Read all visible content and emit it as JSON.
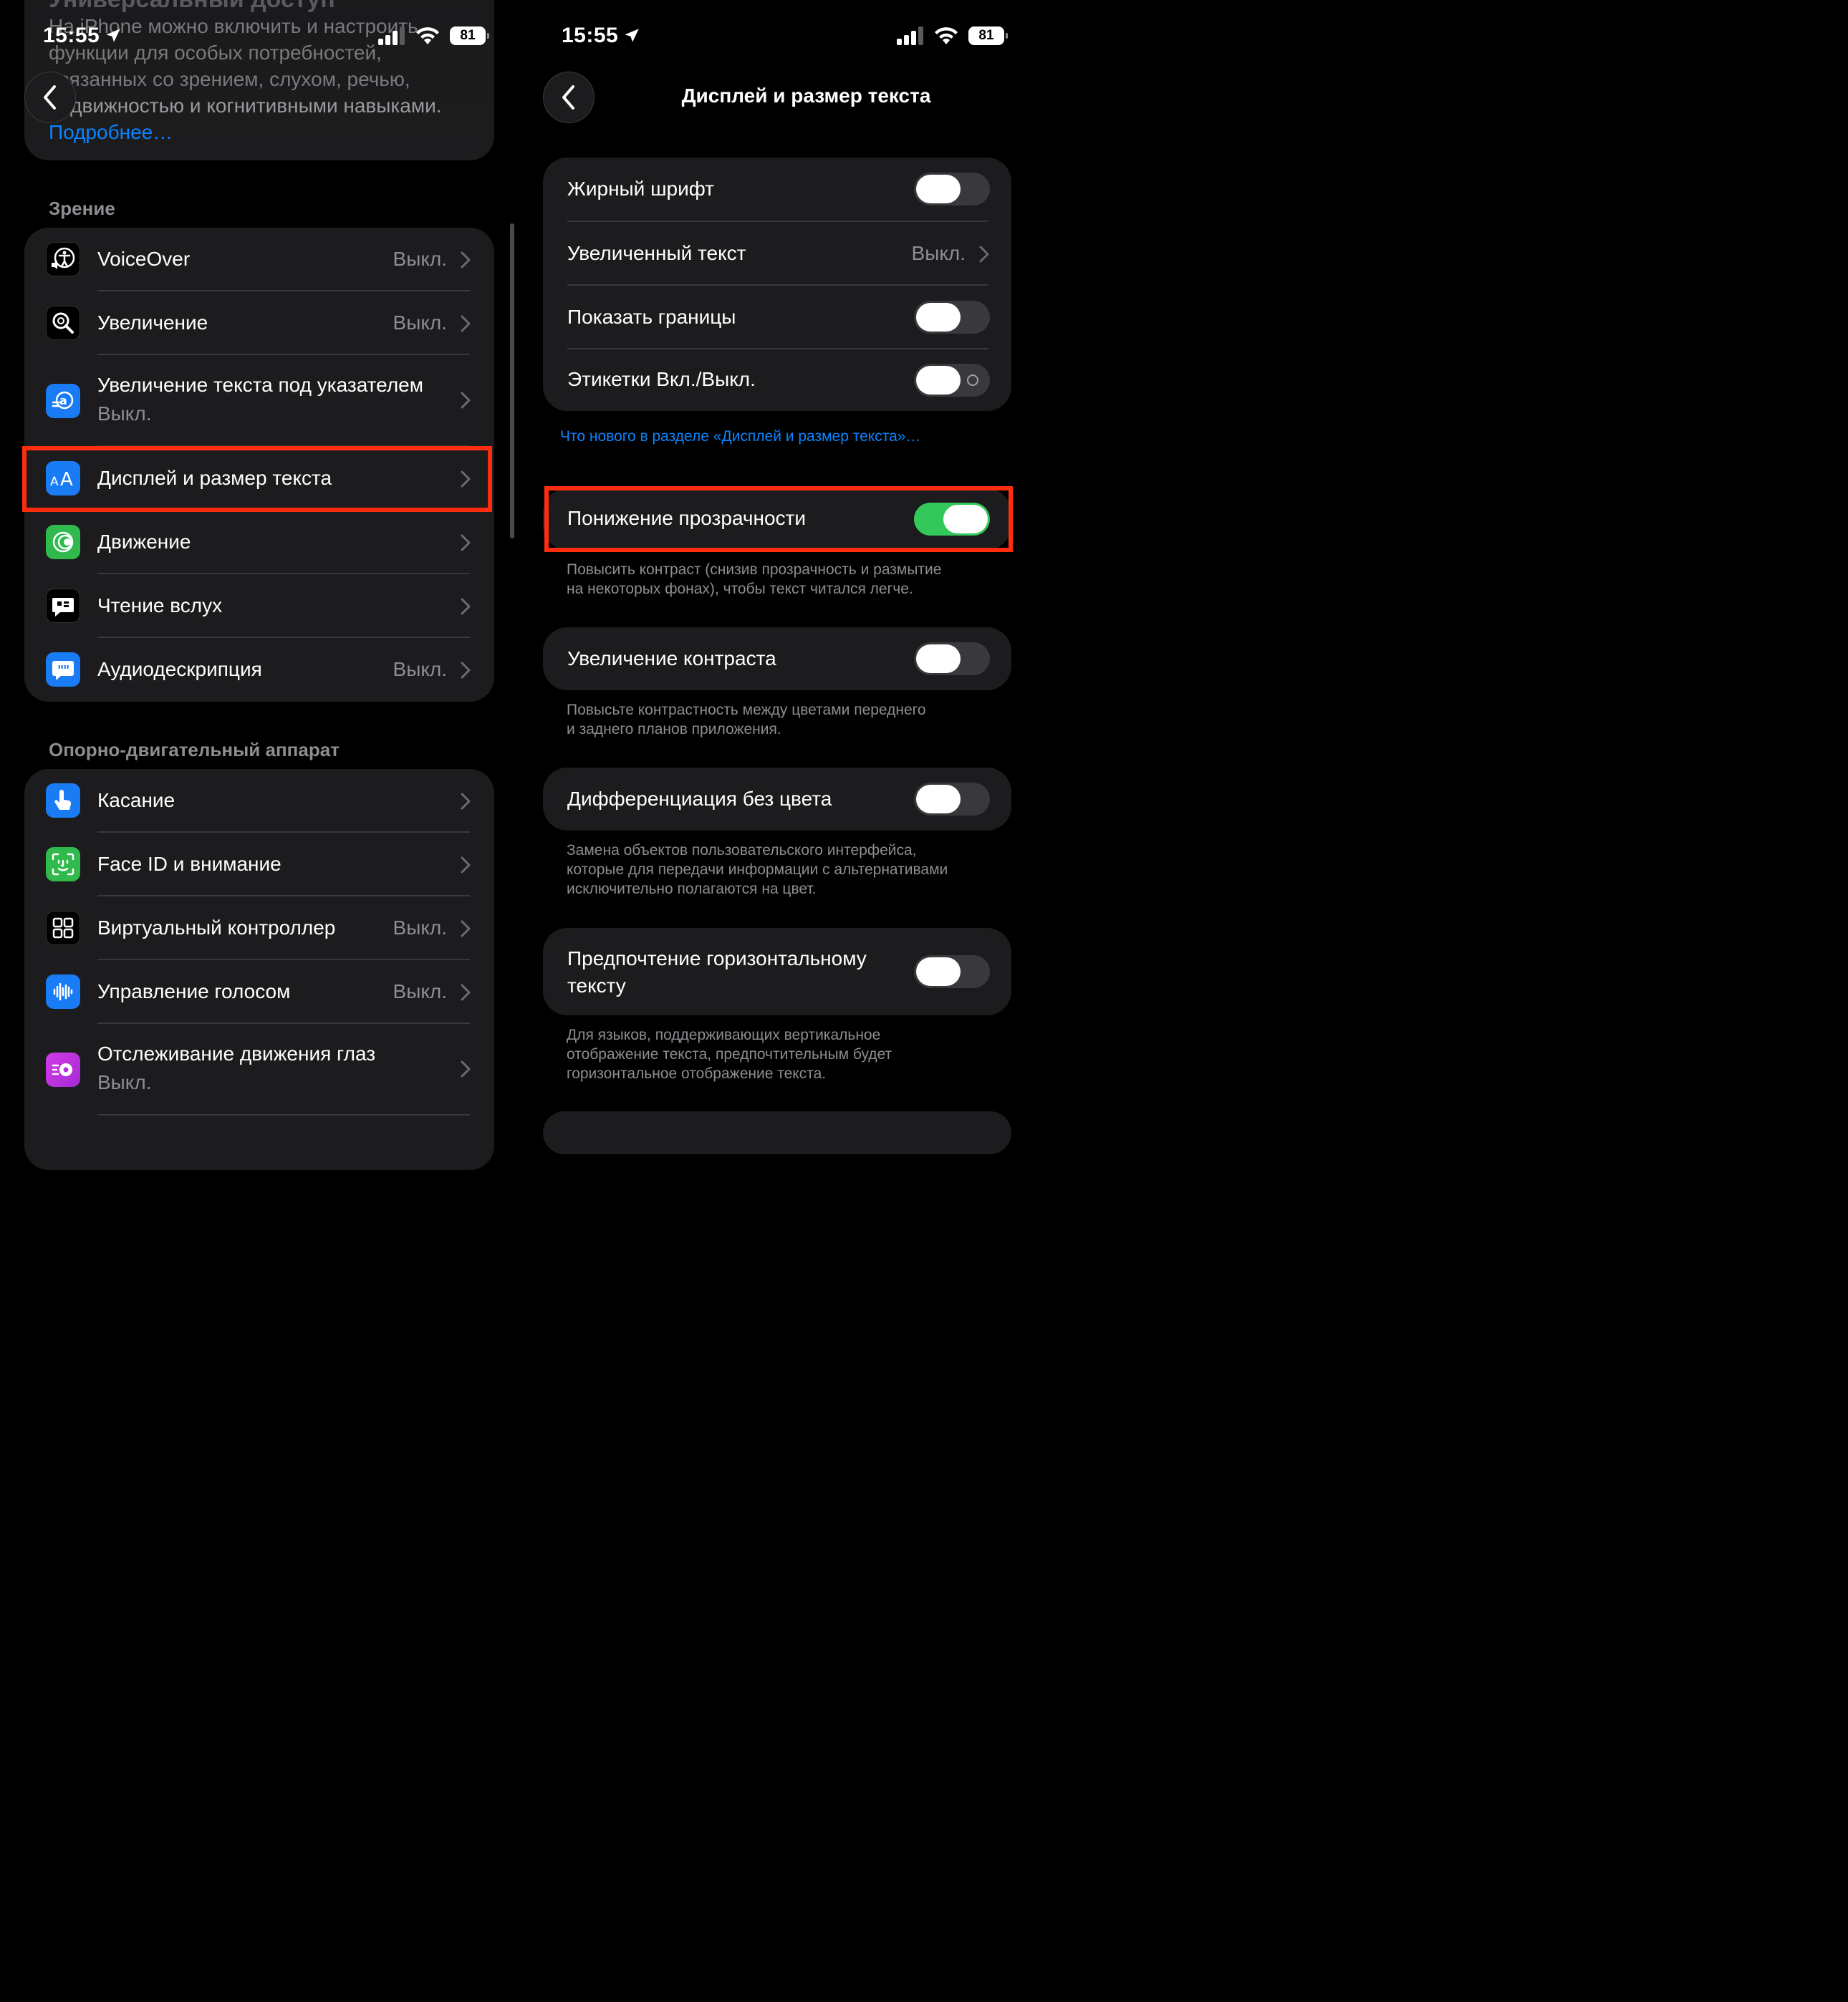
{
  "left": {
    "status": {
      "time": "15:55",
      "battery": "81"
    },
    "intro": {
      "title": "Универсальный доступ",
      "text_lines": [
        "На iPhone можно включить и настроить",
        "функции для особых потребностей,",
        "связанных со зрением, слухом, речью,",
        "подвижностью и когнитивными навыками."
      ],
      "link": "Подробнее…"
    },
    "vision": {
      "header": "Зрение",
      "items": [
        {
          "label": "VoiceOver",
          "value": "Выкл.",
          "icon": "voiceover-icon"
        },
        {
          "label": "Увеличение",
          "value": "Выкл.",
          "icon": "zoom-icon"
        },
        {
          "label": "Увеличение текста под указателем",
          "sublabel": "Выкл.",
          "icon": "hover-text-icon"
        },
        {
          "label": "Дисплей и размер текста",
          "icon": "display-text-size-icon"
        },
        {
          "label": "Движение",
          "icon": "motion-icon"
        },
        {
          "label": "Чтение вслух",
          "icon": "spoken-content-icon"
        },
        {
          "label": "Аудиодескрипция",
          "value": "Выкл.",
          "icon": "audio-description-icon"
        }
      ]
    },
    "physical": {
      "header": "Опорно-двигательный аппарат",
      "items": [
        {
          "label": "Касание",
          "icon": "touch-icon"
        },
        {
          "label": "Face ID и внимание",
          "icon": "face-id-icon"
        },
        {
          "label": "Виртуальный контроллер",
          "value": "Выкл.",
          "icon": "switch-control-icon"
        },
        {
          "label": "Управление голосом",
          "value": "Выкл.",
          "icon": "voice-control-icon"
        },
        {
          "label": "Отслеживание движения глаз",
          "sublabel": "Выкл.",
          "icon": "eye-tracking-icon"
        }
      ]
    }
  },
  "right": {
    "status": {
      "time": "15:55",
      "battery": "81"
    },
    "nav_title": "Дисплей и размер текста",
    "group1": {
      "items": [
        {
          "label": "Жирный шрифт",
          "toggle": false
        },
        {
          "label": "Увеличенный текст",
          "value": "Выкл."
        },
        {
          "label": "Показать границы",
          "toggle": false
        },
        {
          "label": "Этикетки Вкл./Выкл.",
          "toggle": false
        }
      ]
    },
    "whats_new_link": "Что нового в разделе «Дисплей и размер текста»…",
    "reduce_transparency": {
      "label": "Понижение прозрачности",
      "toggle": true,
      "footer": [
        "Повысить контраст (снизив прозрачность и размытие",
        "на некоторых фонах), чтобы текст читался легче."
      ]
    },
    "increase_contrast": {
      "label": "Увеличение контраста",
      "toggle": false,
      "footer": [
        "Повысьте контрастность между цветами переднего",
        "и заднего планов приложения."
      ]
    },
    "differentiate_without_color": {
      "label": "Дифференциация без цвета",
      "toggle": false,
      "footer": [
        "Замена объектов пользовательского интерфейса,",
        "которые для передачи информации с альтернативами",
        "исключительно полагаются на цвет."
      ]
    },
    "prefer_horizontal_text": {
      "label_lines": [
        "Предпочтение горизонтальному",
        "тексту"
      ],
      "toggle": false,
      "footer": [
        "Для языков, поддерживающих вертикальное",
        "отображение текста, предпочтительным будет",
        "горизонтальное отображение текста."
      ]
    }
  },
  "colors": {
    "accent_link": "#0a84ff",
    "toggle_on": "#34c759",
    "highlight": "#ff2d10"
  }
}
